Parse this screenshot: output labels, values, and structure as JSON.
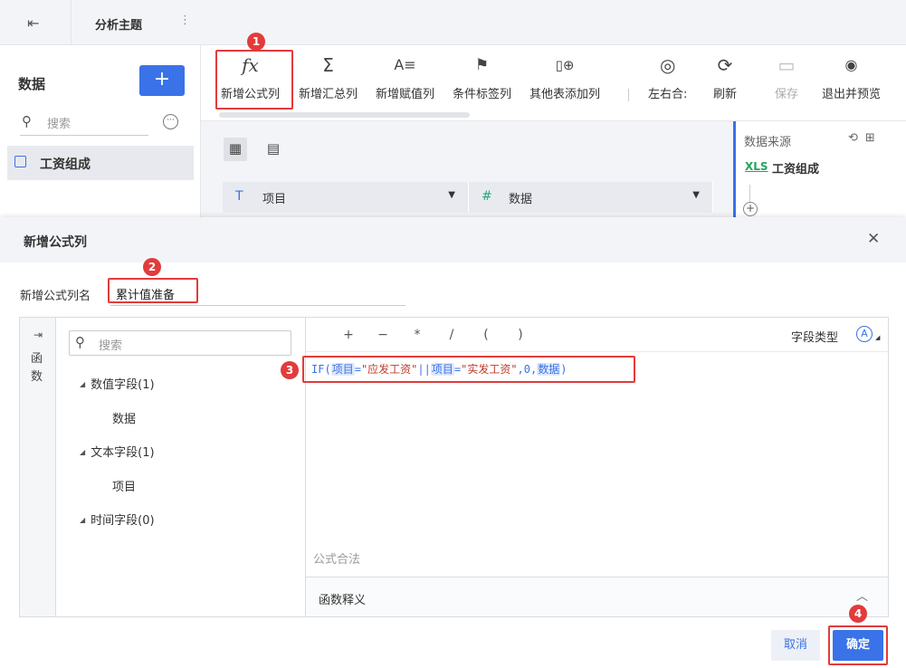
{
  "topbar": {
    "back_icon": "exit-icon",
    "title": "分析主题",
    "more": "⋮"
  },
  "sidebar": {
    "title": "数据",
    "add_label": "+",
    "search_placeholder": "搜索",
    "more_label": "···",
    "items": [
      {
        "label": "工资组成",
        "icon": "chart-icon"
      }
    ]
  },
  "toolbar": {
    "tools": [
      {
        "icon": "fx",
        "label": "新增公式列"
      },
      {
        "icon": "Σ",
        "label": "新增汇总列"
      },
      {
        "icon": "A≡",
        "label": "新增赋值列"
      },
      {
        "icon": "⚑",
        "label": "条件标签列"
      },
      {
        "icon": "▯⊕",
        "label": "其他表添加列"
      },
      {
        "icon": "◎",
        "label": "左右合:"
      },
      {
        "icon": "⟳",
        "label": "刷新"
      },
      {
        "icon": "▭",
        "label": "保存"
      },
      {
        "icon": "◉",
        "label": "退出并预览"
      }
    ]
  },
  "grid": {
    "columns": [
      {
        "type_icon": "T",
        "label": "项目"
      },
      {
        "type_icon": "#",
        "label": "数据"
      }
    ]
  },
  "datasource": {
    "title": "数据来源",
    "xls": "XLS",
    "name": "工资组成"
  },
  "dialog": {
    "title": "新增公式列",
    "close": "✕",
    "name_label": "新增公式列名",
    "name_value": "累计值准备",
    "fn_tab_arrow": "⇥",
    "fn_tab": "函数",
    "field_search_placeholder": "搜索",
    "tree": [
      {
        "label": "数值字段(1)",
        "children": [
          "数据"
        ]
      },
      {
        "label": "文本字段(1)",
        "children": [
          "项目"
        ]
      },
      {
        "label": "时间字段(0)",
        "children": []
      }
    ],
    "operators": [
      "+",
      "−",
      "*",
      "/",
      "(",
      ")"
    ],
    "field_type_label": "字段类型",
    "field_type_icon": "A",
    "formula": {
      "p1": "IF(",
      "f1": "项目",
      "p2": "=",
      "s1": "\"应发工资\"",
      "p3": "||",
      "f2": "项目",
      "p4": "=",
      "s2": "\"实发工资\"",
      "p5": ",0,",
      "f3": "数据",
      "p6": ")"
    },
    "validation": "公式合法",
    "function_desc": "函数释义",
    "cancel": "取消",
    "ok": "确定"
  },
  "badges": [
    "1",
    "2",
    "3",
    "4"
  ]
}
